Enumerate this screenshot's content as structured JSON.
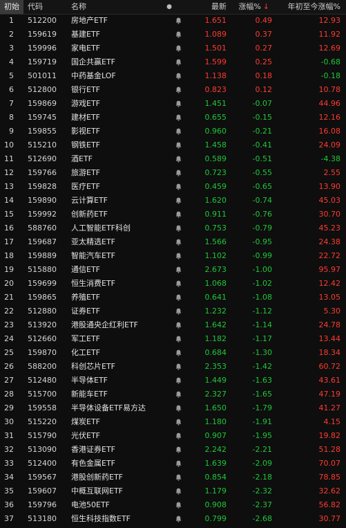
{
  "header": {
    "corner": "初始",
    "code": "代码",
    "name": "名称",
    "dot": "●",
    "last": "最新",
    "change": "涨幅%",
    "change_sort_arrow": "↓",
    "ytd": "年初至今涨幅%"
  },
  "colors": {
    "up": "#ff3b30",
    "down": "#1fc838",
    "background": "#0e0e0e"
  },
  "row_icon": "bell-icon",
  "rows": [
    {
      "idx": "1",
      "code": "512200",
      "name": "房地产ETF",
      "last": "1.651",
      "chg": "0.49",
      "ytd": "12.93"
    },
    {
      "idx": "2",
      "code": "159619",
      "name": "基建ETF",
      "last": "1.089",
      "chg": "0.37",
      "ytd": "11.92"
    },
    {
      "idx": "3",
      "code": "159996",
      "name": "家电ETF",
      "last": "1.501",
      "chg": "0.27",
      "ytd": "12.69"
    },
    {
      "idx": "4",
      "code": "159719",
      "name": "国企共赢ETF",
      "last": "1.599",
      "chg": "0.25",
      "ytd": "-0.68"
    },
    {
      "idx": "5",
      "code": "501011",
      "name": "中药基金LOF",
      "last": "1.138",
      "chg": "0.18",
      "ytd": "-0.18"
    },
    {
      "idx": "6",
      "code": "512800",
      "name": "银行ETF",
      "last": "0.823",
      "chg": "0.12",
      "ytd": "10.78"
    },
    {
      "idx": "7",
      "code": "159869",
      "name": "游戏ETF",
      "last": "1.451",
      "chg": "-0.07",
      "ytd": "44.96"
    },
    {
      "idx": "8",
      "code": "159745",
      "name": "建材ETF",
      "last": "0.655",
      "chg": "-0.15",
      "ytd": "12.16"
    },
    {
      "idx": "9",
      "code": "159855",
      "name": "影视ETF",
      "last": "0.960",
      "chg": "-0.21",
      "ytd": "16.08"
    },
    {
      "idx": "10",
      "code": "515210",
      "name": "钢铁ETF",
      "last": "1.458",
      "chg": "-0.41",
      "ytd": "24.09"
    },
    {
      "idx": "11",
      "code": "512690",
      "name": "酒ETF",
      "last": "0.589",
      "chg": "-0.51",
      "ytd": "-4.38"
    },
    {
      "idx": "12",
      "code": "159766",
      "name": "旅游ETF",
      "last": "0.723",
      "chg": "-0.55",
      "ytd": "2.55"
    },
    {
      "idx": "13",
      "code": "159828",
      "name": "医疗ETF",
      "last": "0.459",
      "chg": "-0.65",
      "ytd": "13.90"
    },
    {
      "idx": "14",
      "code": "159890",
      "name": "云计算ETF",
      "last": "1.620",
      "chg": "-0.74",
      "ytd": "45.03"
    },
    {
      "idx": "15",
      "code": "159992",
      "name": "创新药ETF",
      "last": "0.911",
      "chg": "-0.76",
      "ytd": "30.70"
    },
    {
      "idx": "16",
      "code": "588760",
      "name": "人工智能ETF科创",
      "last": "0.753",
      "chg": "-0.79",
      "ytd": "45.23"
    },
    {
      "idx": "17",
      "code": "159687",
      "name": "亚太精选ETF",
      "last": "1.566",
      "chg": "-0.95",
      "ytd": "24.38"
    },
    {
      "idx": "18",
      "code": "159889",
      "name": "智能汽车ETF",
      "last": "1.102",
      "chg": "-0.99",
      "ytd": "22.72"
    },
    {
      "idx": "19",
      "code": "515880",
      "name": "通信ETF",
      "last": "2.673",
      "chg": "-1.00",
      "ytd": "95.97"
    },
    {
      "idx": "20",
      "code": "159699",
      "name": "恒生消费ETF",
      "last": "1.068",
      "chg": "-1.02",
      "ytd": "12.42"
    },
    {
      "idx": "21",
      "code": "159865",
      "name": "养殖ETF",
      "last": "0.641",
      "chg": "-1.08",
      "ytd": "13.05"
    },
    {
      "idx": "22",
      "code": "512880",
      "name": "证券ETF",
      "last": "1.232",
      "chg": "-1.12",
      "ytd": "5.30"
    },
    {
      "idx": "23",
      "code": "513920",
      "name": "港股通央企红利ETF",
      "last": "1.642",
      "chg": "-1.14",
      "ytd": "24.78"
    },
    {
      "idx": "24",
      "code": "512660",
      "name": "军工ETF",
      "last": "1.182",
      "chg": "-1.17",
      "ytd": "13.44"
    },
    {
      "idx": "25",
      "code": "159870",
      "name": "化工ETF",
      "last": "0.684",
      "chg": "-1.30",
      "ytd": "18.34"
    },
    {
      "idx": "26",
      "code": "588200",
      "name": "科创芯片ETF",
      "last": "2.353",
      "chg": "-1.42",
      "ytd": "60.72"
    },
    {
      "idx": "27",
      "code": "512480",
      "name": "半导体ETF",
      "last": "1.449",
      "chg": "-1.63",
      "ytd": "43.61"
    },
    {
      "idx": "28",
      "code": "515700",
      "name": "新能车ETF",
      "last": "2.327",
      "chg": "-1.65",
      "ytd": "47.19"
    },
    {
      "idx": "29",
      "code": "159558",
      "name": "半导体设备ETF易方达",
      "last": "1.650",
      "chg": "-1.79",
      "ytd": "41.27"
    },
    {
      "idx": "30",
      "code": "515220",
      "name": "煤炭ETF",
      "last": "1.180",
      "chg": "-1.91",
      "ytd": "4.15"
    },
    {
      "idx": "31",
      "code": "515790",
      "name": "光伏ETF",
      "last": "0.907",
      "chg": "-1.95",
      "ytd": "19.82"
    },
    {
      "idx": "32",
      "code": "513090",
      "name": "香港证券ETF",
      "last": "2.242",
      "chg": "-2.21",
      "ytd": "51.28"
    },
    {
      "idx": "33",
      "code": "512400",
      "name": "有色金属ETF",
      "last": "1.639",
      "chg": "-2.09",
      "ytd": "70.07"
    },
    {
      "idx": "34",
      "code": "159567",
      "name": "港股创新药ETF",
      "last": "0.854",
      "chg": "-2.18",
      "ytd": "78.85"
    },
    {
      "idx": "35",
      "code": "159607",
      "name": "中概互联网ETF",
      "last": "1.179",
      "chg": "-2.32",
      "ytd": "32.62"
    },
    {
      "idx": "36",
      "code": "159796",
      "name": "电池50ETF",
      "last": "0.908",
      "chg": "-2.37",
      "ytd": "56.82"
    },
    {
      "idx": "37",
      "code": "513180",
      "name": "恒生科技指数ETF",
      "last": "0.799",
      "chg": "-2.68",
      "ytd": "30.77"
    }
  ]
}
